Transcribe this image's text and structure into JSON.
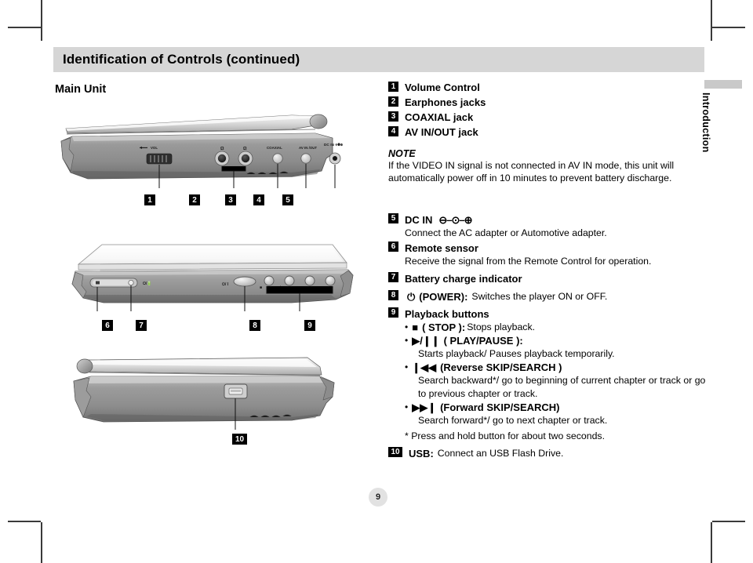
{
  "header": {
    "title": "Identification of Controls (continued)",
    "subtitle": "Main Unit"
  },
  "side_tab": {
    "label": "Introduction"
  },
  "page_number": "9",
  "items_top": [
    {
      "num": "1",
      "label": "Volume Control"
    },
    {
      "num": "2",
      "label": "Earphones jacks"
    },
    {
      "num": "3",
      "label": "COAXIAL jack"
    },
    {
      "num": "4",
      "label": "AV IN/OUT jack"
    }
  ],
  "note": {
    "title": "NOTE",
    "body": "If the VIDEO IN signal is not connected in AV IN mode, this unit will automatically power off in 10 minutes to prevent battery discharge."
  },
  "items_bottom": {
    "dc_in": {
      "num": "5",
      "label": "DC IN",
      "symbol": "⊖–⊙–⊕",
      "desc": "Connect the AC adapter or Automotive adapter."
    },
    "remote_sensor": {
      "num": "6",
      "label": "Remote sensor",
      "desc": "Receive the signal from the Remote Control for operation."
    },
    "battery": {
      "num": "7",
      "label": "Battery charge indicator"
    },
    "power": {
      "num": "8",
      "symbol": "⏻",
      "label": "(POWER):",
      "desc": "Switches the player ON or OFF."
    },
    "playback": {
      "num": "9",
      "label": "Playback buttons",
      "buttons": [
        {
          "glyph": "■",
          "name": "( STOP ):",
          "desc": "Stops playback.",
          "sub": ""
        },
        {
          "glyph": "▶/❙❙",
          "name": "( PLAY/PAUSE ):",
          "desc": "",
          "sub": "Starts playback/ Pauses playback temporarily."
        },
        {
          "glyph": "❙◀◀",
          "name": "(Reverse SKIP/SEARCH )",
          "desc": "",
          "sub": "Search backward*/ go to beginning of current chapter or track or go to previous chapter or track."
        },
        {
          "glyph": "▶▶❙",
          "name": "(Forward SKIP/SEARCH)",
          "desc": "",
          "sub": "Search forward*/ go to next chapter or track."
        }
      ],
      "footnote": "* Press and hold button for about two seconds."
    },
    "usb": {
      "num": "10",
      "label": "USB:",
      "desc": "Connect an USB Flash Drive."
    }
  },
  "illustration_side": {
    "callouts": [
      "1",
      "2",
      "3",
      "4",
      "5"
    ],
    "port_labels": [
      "VOL",
      "COAXIAL",
      "AV IN /OUT",
      "DC IN"
    ]
  },
  "illustration_front": {
    "callouts": [
      "6",
      "7",
      "8",
      "9"
    ],
    "port_labels": [
      "⏻/ I"
    ]
  },
  "illustration_right": {
    "callouts": [
      "10"
    ]
  }
}
